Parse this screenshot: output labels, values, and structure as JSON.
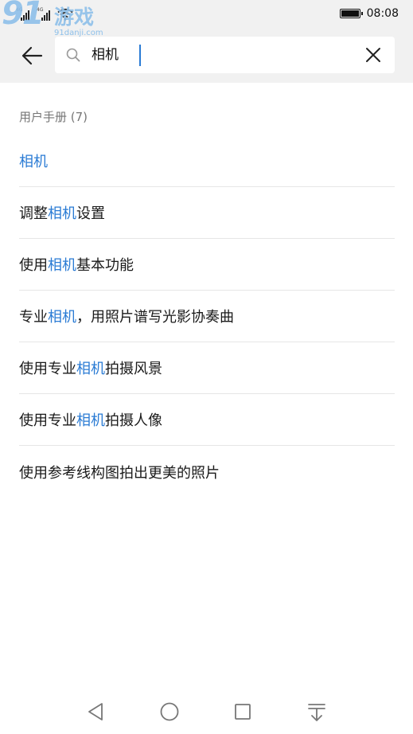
{
  "status_bar": {
    "network_1": "4G",
    "network_2": "4G",
    "time": "08:08",
    "battery_level": 1.0
  },
  "watermark": {
    "logo_number": "91",
    "logo_text": "游戏",
    "url": "91danji.com"
  },
  "search": {
    "query": "相机",
    "placeholder": ""
  },
  "section": {
    "title": "用户手册 (7)"
  },
  "results": [
    {
      "pre": "",
      "hl": "相机",
      "post": ""
    },
    {
      "pre": "调整",
      "hl": "相机",
      "post": "设置"
    },
    {
      "pre": "使用",
      "hl": "相机",
      "post": "基本功能"
    },
    {
      "pre": "专业",
      "hl": "相机",
      "post": "，用照片谱写光影协奏曲"
    },
    {
      "pre": "使用专业",
      "hl": "相机",
      "post": "拍摄风景"
    },
    {
      "pre": "使用专业",
      "hl": "相机",
      "post": "拍摄人像"
    },
    {
      "pre": "使用参考线构图拍出更美的照片",
      "hl": "",
      "post": ""
    }
  ],
  "colors": {
    "highlight": "#2a7bd4",
    "header_bg": "#f1f1f1",
    "section_text": "#767676"
  },
  "icons": {
    "back": "arrow-left-icon",
    "search": "magnifier-icon",
    "clear": "close-x-icon",
    "nav_back": "triangle-back-icon",
    "nav_home": "circle-home-icon",
    "nav_recent": "square-recents-icon",
    "nav_notifications": "pull-down-icon"
  }
}
